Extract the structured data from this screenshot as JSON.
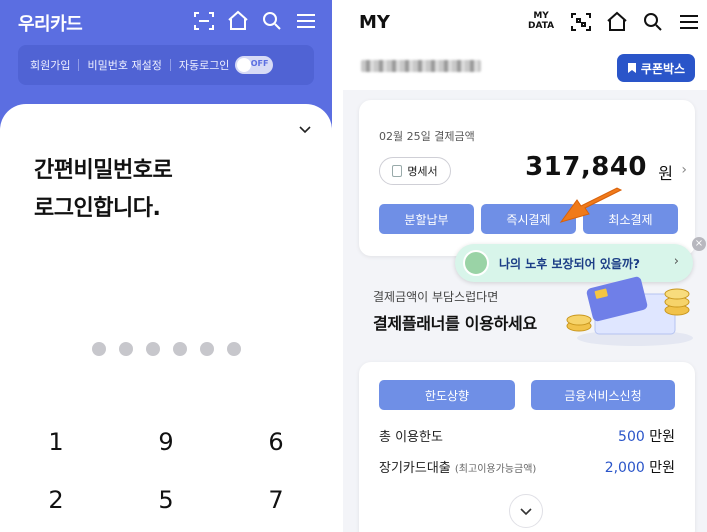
{
  "left": {
    "brand": "우리카드",
    "links": [
      "회원가입",
      "비밀번호 재설정",
      "자동로그인"
    ],
    "toggle_state": "OFF",
    "title_line1": "간편비밀번호로",
    "title_line2": "로그인합니다.",
    "pin_dots_count": 6,
    "keypad": [
      "1",
      "9",
      "6",
      "2",
      "5",
      "7"
    ]
  },
  "right": {
    "header": {
      "title": "MY",
      "mydata_line1": "MY",
      "mydata_line2": "DATA"
    },
    "coupon_label": "쿠폰박스",
    "payment": {
      "date_label": "02월 25일 결제금액",
      "statement_label": "명세서",
      "amount": "317,840",
      "unit": "원",
      "buttons": [
        "분할납부",
        "즉시결제",
        "최소결제"
      ]
    },
    "promo": {
      "text": "나의 노후 보장되어 있을까?",
      "close": "×"
    },
    "burden": {
      "line1": "결제금액이 부담스럽다면",
      "line2": "결제플래너를 이용하세요"
    },
    "limits": {
      "buttons": [
        "한도상향",
        "금융서비스신청"
      ],
      "total_label": "총 이용한도",
      "total_value": "500",
      "total_unit": "만원",
      "loan_label": "장기카드대출",
      "loan_note": "(최고이용가능금액)",
      "loan_value": "2,000",
      "loan_unit": "만원"
    }
  },
  "colors": {
    "brand_blue": "#5b6ee1",
    "button_blue": "#6f8fe6",
    "coupon_blue": "#2a55c9",
    "arrow_orange": "#f07a1a",
    "promo_green": "#d8f5ea"
  }
}
